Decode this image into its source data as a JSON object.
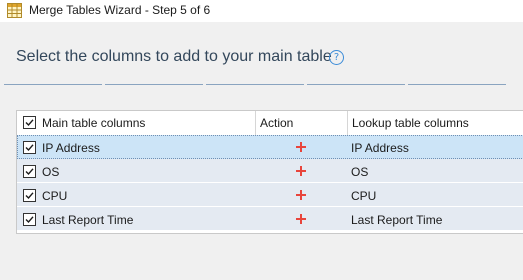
{
  "window": {
    "title": "Merge Tables Wizard - Step 5 of 6",
    "icon": "table-grid-icon"
  },
  "header": {
    "heading": "Select the columns to add to your main table",
    "help_glyph": "?"
  },
  "steps": {
    "total": 5,
    "style_color": "#8aa4c0"
  },
  "table": {
    "columns": {
      "main": "Main table columns",
      "action": "Action",
      "lookup": "Lookup table columns"
    },
    "header_checked": true,
    "rows": [
      {
        "main": "IP Address",
        "action_icon": "plus-icon",
        "lookup": "IP Address",
        "checked": true,
        "selected": true
      },
      {
        "main": "OS",
        "action_icon": "plus-icon",
        "lookup": "OS",
        "checked": true,
        "selected": false
      },
      {
        "main": "CPU",
        "action_icon": "plus-icon",
        "lookup": "CPU",
        "checked": true,
        "selected": false
      },
      {
        "main": "Last Report Time",
        "action_icon": "plus-icon",
        "lookup": "Last Report Time",
        "checked": true,
        "selected": false
      }
    ]
  },
  "colors": {
    "heading": "#33475b",
    "plus": "#e8453c",
    "selected_row": "#cce4f7",
    "row": "#e4eaf2"
  }
}
